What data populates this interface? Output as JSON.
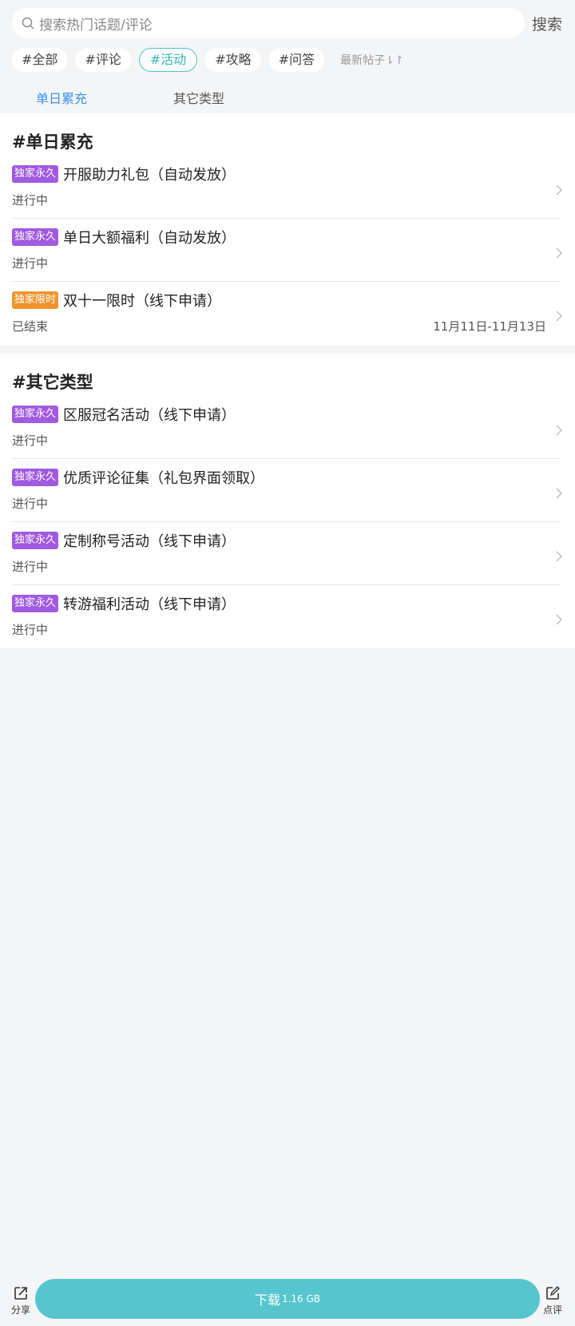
{
  "search": {
    "placeholder": "搜索热门话题/评论",
    "button": "搜索"
  },
  "filter_tags": [
    "#全部",
    "#评论",
    "#活动",
    "#攻略",
    "#问答"
  ],
  "active_tag": "#活动",
  "sort_label": "最新帖子⇂↾",
  "sub_tabs": [
    "单日累充",
    "其它类型"
  ],
  "active_sub_tab": "单日累充",
  "sections": [
    {
      "title": "#单日累充",
      "items": [
        {
          "badge": "独家永久",
          "title": "开服助力礼包（自动发放）",
          "status": "进行中",
          "date": ""
        },
        {
          "badge": "独家永久",
          "title": "单日大额福利（自动发放）",
          "status": "进行中",
          "date": ""
        },
        {
          "badge": "独家限时",
          "title": "双十一限时（线下申请）",
          "status": "已结束",
          "date": "11月11日-11月13日"
        }
      ]
    },
    {
      "title": "#其它类型",
      "items": [
        {
          "badge": "独家永久",
          "title": "区服冠名活动（线下申请）",
          "status": "进行中",
          "date": ""
        },
        {
          "badge": "独家永久",
          "title": "优质评论征集（礼包界面领取）",
          "status": "进行中",
          "date": ""
        },
        {
          "badge": "独家永久",
          "title": "定制称号活动（线下申请）",
          "status": "进行中",
          "date": ""
        },
        {
          "badge": "独家永久",
          "title": "转游福利活动（线下申请）",
          "status": "进行中",
          "date": ""
        }
      ]
    }
  ],
  "bottom_bar": {
    "share_label": "分享",
    "download_label": "下载",
    "download_size": "1.16 GB",
    "review_label": "点评"
  },
  "colors": {
    "accent_teal": "#57c5cd",
    "tab_blue": "#3b8fe8",
    "badge_purple": "#a05ae0",
    "badge_orange": "#f0952e"
  }
}
